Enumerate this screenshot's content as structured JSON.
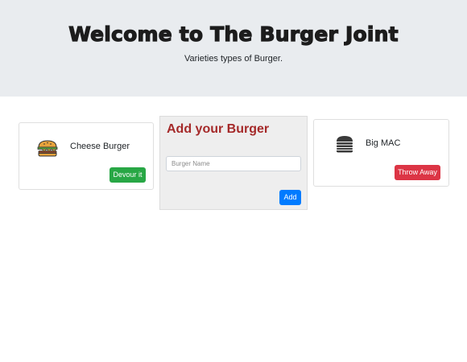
{
  "hero": {
    "title": "Welcome to The Burger Joint",
    "subtitle": "Varieties types of Burger."
  },
  "burgers_left": [
    {
      "name": "Cheese Burger",
      "icon": "cheeseburger-icon",
      "action_label": "Devour it"
    }
  ],
  "add_form": {
    "title": "Add your Burger",
    "input_placeholder": "Burger Name",
    "input_value": "",
    "submit_label": "Add"
  },
  "burgers_right": [
    {
      "name": "Big MAC",
      "icon": "hamburger-icon",
      "action_label": "Throw Away"
    }
  ],
  "colors": {
    "devour_button": "#28a745",
    "throw_button": "#dc3545",
    "add_button": "#007bff",
    "form_title": "#a52a2a",
    "hero_background": "#e9ecef"
  }
}
